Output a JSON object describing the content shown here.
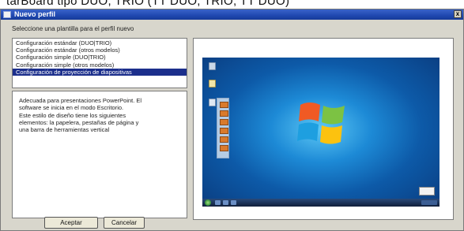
{
  "top_strip_text": "tarBoard tipo DUO, TRIO (TT DUO, TRIO, TT DUO)",
  "dialog": {
    "title": "Nuevo perfil",
    "close_label": "x",
    "prompt": "Seleccione una plantilla para el perfil nuevo",
    "templates": [
      "Configuración estándar (DUO|TRIO)",
      "Configuración estándar (otros modelos)",
      "Configuración simple (DUO|TRIO)",
      "Configuración simple (otros modelos)",
      "Configuración de proyección de diapositivas"
    ],
    "selected_index": 4,
    "description_lines": [
      "Adecuada para presentaciones PowerPoint. El",
      "software se inicia en el modo Escritorio.",
      "Este estilo de diseño tiene los siguientes",
      "elementos: la papelera, pestañas de página y",
      "una barra de herramientas vertical"
    ],
    "accept_label": "Aceptar",
    "cancel_label": "Cancelar"
  },
  "preview": {
    "alt": "Windows 7 desktop preview",
    "colors": {
      "titlebar": "#1f48b0",
      "selection": "#1c2f8c",
      "dialog_bg": "#d8d6cc"
    }
  }
}
